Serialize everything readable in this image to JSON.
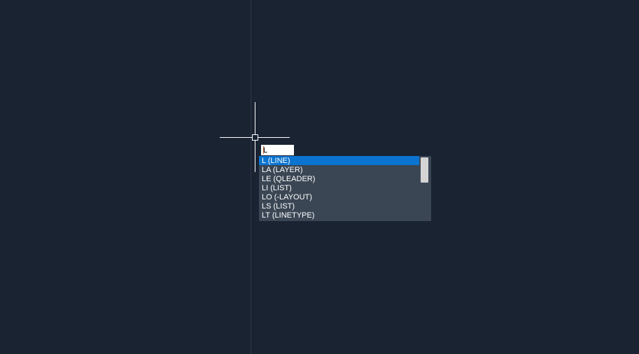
{
  "command_input": {
    "value": "L",
    "placeholder": ""
  },
  "autocomplete": {
    "items": [
      {
        "label": "L (LINE)",
        "selected": true
      },
      {
        "label": "LA (LAYER)",
        "selected": false
      },
      {
        "label": "LE (QLEADER)",
        "selected": false
      },
      {
        "label": "LI (LIST)",
        "selected": false
      },
      {
        "label": "LO (-LAYOUT)",
        "selected": false
      },
      {
        "label": "LS (LIST)",
        "selected": false
      },
      {
        "label": "LT (LINETYPE)",
        "selected": false
      }
    ]
  },
  "colors": {
    "background": "#1a2332",
    "crosshair": "#ffffff",
    "popup_bg": "#3a4654",
    "selected": "#0b74d1",
    "scrollbar_thumb": "#d4d4d4"
  }
}
